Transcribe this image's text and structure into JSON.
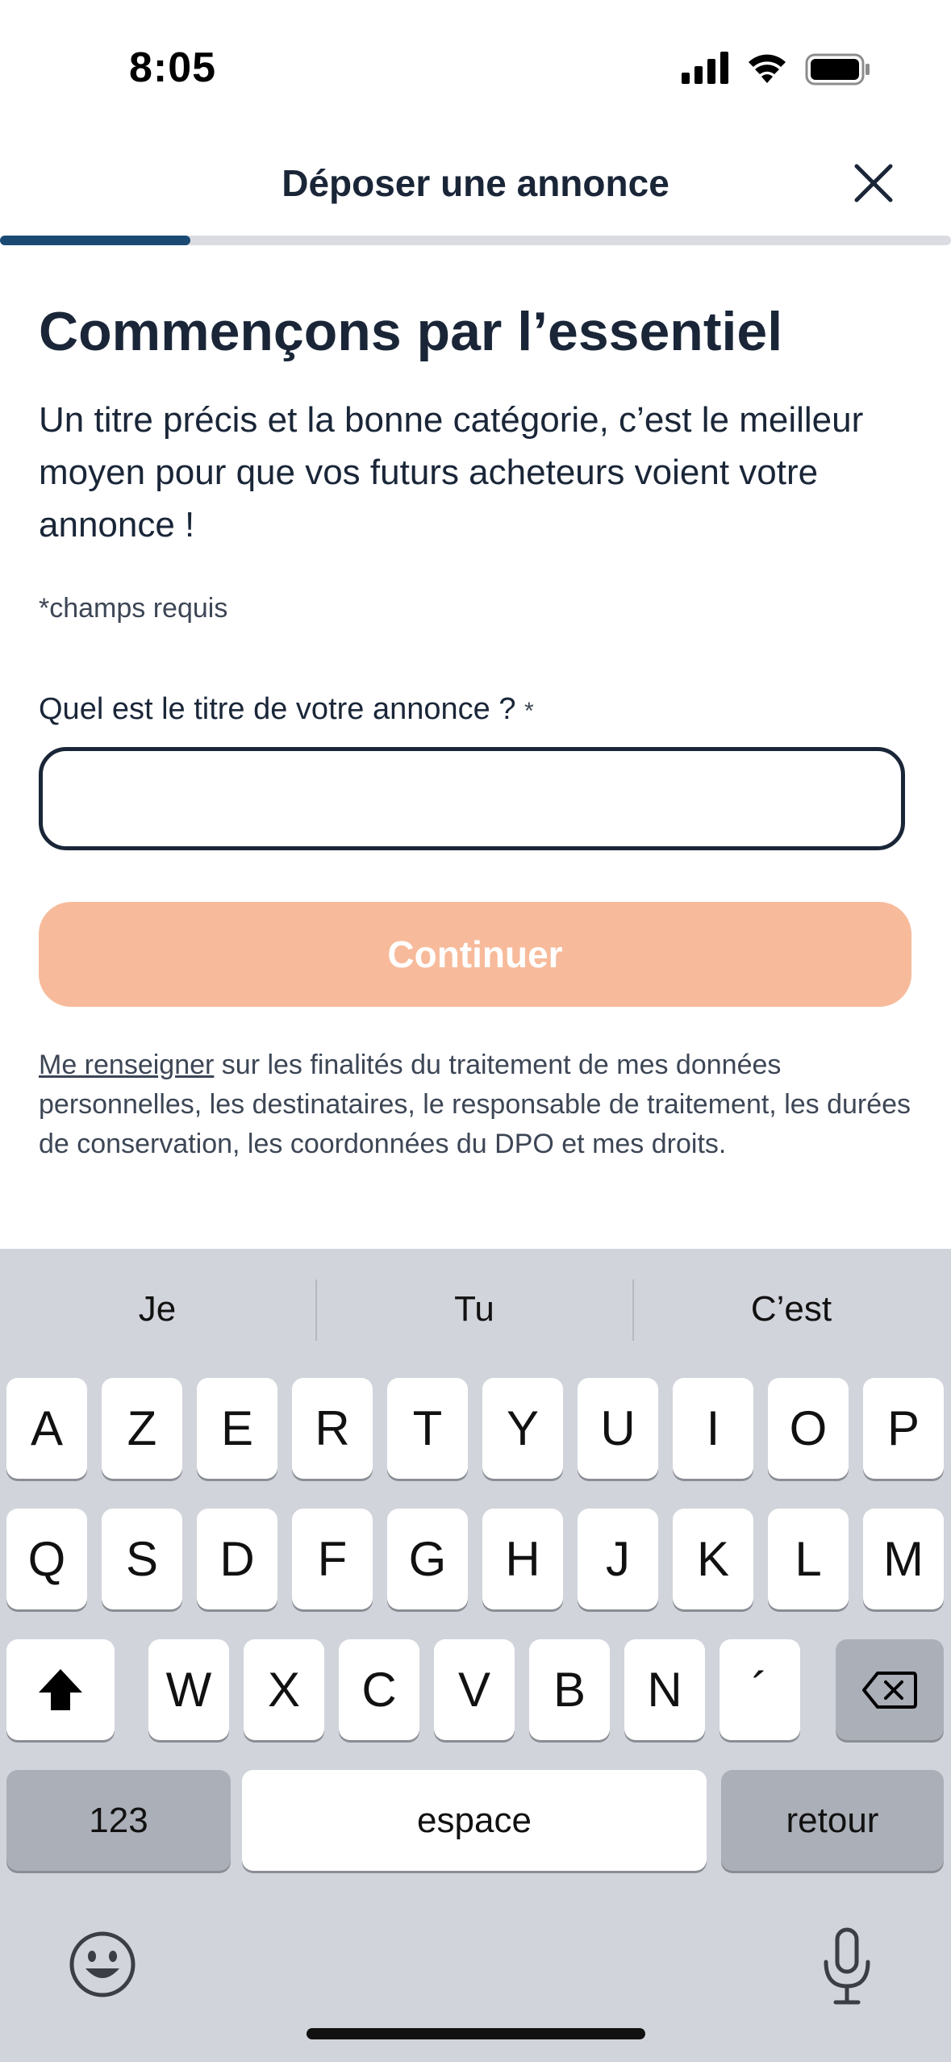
{
  "status_bar": {
    "time": "8:05"
  },
  "header": {
    "title": "Déposer une annonce",
    "progress_fraction": 0.2,
    "close_icon": "close-icon"
  },
  "content": {
    "heading": "Commençons par l’essentiel",
    "intro": "Un titre précis et la bonne catégorie, c’est le meilleur moyen pour que vos futurs acheteurs voient votre annonce !",
    "required_note": "*champs requis",
    "field_label": "Quel est le titre de votre annonce ?",
    "field_required_mark": "*",
    "title_input_value": "",
    "continue_label": "Continuer",
    "legal_link": "Me renseigner",
    "legal_text": " sur les finalités du traitement de mes données personnelles, les destinataires, le responsable de traitement, les durées de conservation, les coordonnées du DPO et mes droits."
  },
  "colors": {
    "text_primary": "#1a2638",
    "progress_fill": "#1a4a73",
    "continue_disabled_bg": "#f7bb9b",
    "keyboard_bg": "#d1d4db"
  },
  "keyboard": {
    "suggestions": [
      "Je",
      "Tu",
      "C’est"
    ],
    "row1": [
      "A",
      "Z",
      "E",
      "R",
      "T",
      "Y",
      "U",
      "I",
      "O",
      "P"
    ],
    "row2": [
      "Q",
      "S",
      "D",
      "F",
      "G",
      "H",
      "J",
      "K",
      "L",
      "M"
    ],
    "row3": [
      "W",
      "X",
      "C",
      "V",
      "B",
      "N",
      "´"
    ],
    "numbers_label": "123",
    "space_label": "espace",
    "return_label": "retour",
    "shift_icon": "shift-icon",
    "backspace_icon": "backspace-icon",
    "emoji_icon": "emoji-icon",
    "mic_icon": "microphone-icon"
  }
}
